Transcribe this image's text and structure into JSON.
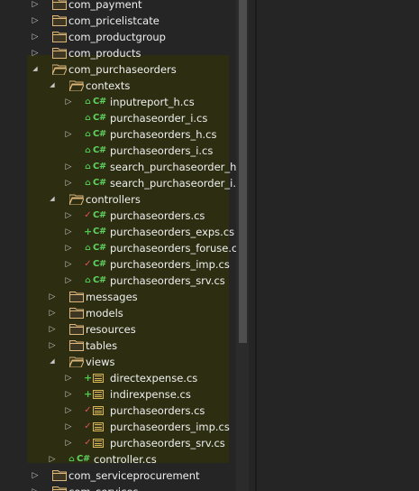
{
  "tree": {
    "rows": [
      {
        "label": "com_payment",
        "kind": "folder",
        "arrow": "collapsed",
        "badge": "",
        "icon": "folder-icon"
      },
      {
        "label": "com_pricelistcate",
        "kind": "folder",
        "arrow": "collapsed",
        "badge": "",
        "icon": "folder-icon"
      },
      {
        "label": "com_productgroup",
        "kind": "folder",
        "arrow": "collapsed",
        "badge": "",
        "icon": "folder-icon"
      },
      {
        "label": "com_products",
        "kind": "folder",
        "arrow": "collapsed",
        "badge": "",
        "icon": "folder-icon"
      },
      {
        "label": "com_purchaseorders",
        "kind": "folder",
        "arrow": "expanded",
        "badge": "",
        "icon": "folder-icon"
      },
      {
        "label": "contexts",
        "kind": "folder",
        "arrow": "expanded",
        "badge": "",
        "icon": "folder-icon"
      },
      {
        "label": "inputreport_h.cs",
        "kind": "cs",
        "arrow": "collapsed",
        "badge": "lock",
        "icon": "csharp-file-icon"
      },
      {
        "label": "purchaseorder_i.cs",
        "kind": "cs",
        "arrow": "none",
        "badge": "lock",
        "icon": "csharp-file-icon"
      },
      {
        "label": "purchaseorders_h.cs",
        "kind": "cs",
        "arrow": "collapsed",
        "badge": "lock",
        "icon": "csharp-file-icon"
      },
      {
        "label": "purchaseorders_i.cs",
        "kind": "cs",
        "arrow": "none",
        "badge": "lock",
        "icon": "csharp-file-icon"
      },
      {
        "label": "search_purchaseorder_h.cs",
        "kind": "cs",
        "arrow": "collapsed",
        "badge": "lock",
        "icon": "csharp-file-icon"
      },
      {
        "label": "search_purchaseorder_i.cs",
        "kind": "cs",
        "arrow": "collapsed",
        "badge": "lock",
        "icon": "csharp-file-icon"
      },
      {
        "label": "controllers",
        "kind": "folder",
        "arrow": "expanded",
        "badge": "",
        "icon": "folder-icon"
      },
      {
        "label": "purchaseorders.cs",
        "kind": "cs",
        "arrow": "collapsed",
        "badge": "check",
        "icon": "csharp-file-icon"
      },
      {
        "label": "purchaseorders_exps.cs",
        "kind": "cs",
        "arrow": "collapsed",
        "badge": "plus",
        "icon": "csharp-file-icon"
      },
      {
        "label": "purchaseorders_foruse.cs",
        "kind": "cs",
        "arrow": "collapsed",
        "badge": "lock",
        "icon": "csharp-file-icon"
      },
      {
        "label": "purchaseorders_imp.cs",
        "kind": "cs",
        "arrow": "collapsed",
        "badge": "check",
        "icon": "csharp-file-icon"
      },
      {
        "label": "purchaseorders_srv.cs",
        "kind": "cs",
        "arrow": "collapsed",
        "badge": "lock",
        "icon": "csharp-file-icon"
      },
      {
        "label": "messages",
        "kind": "folder",
        "arrow": "collapsed",
        "badge": "",
        "icon": "folder-icon"
      },
      {
        "label": "models",
        "kind": "folder",
        "arrow": "collapsed",
        "badge": "",
        "icon": "folder-icon"
      },
      {
        "label": "resources",
        "kind": "folder",
        "arrow": "collapsed",
        "badge": "",
        "icon": "folder-icon"
      },
      {
        "label": "tables",
        "kind": "folder",
        "arrow": "collapsed",
        "badge": "",
        "icon": "folder-icon"
      },
      {
        "label": "views",
        "kind": "folder",
        "arrow": "expanded",
        "badge": "",
        "icon": "folder-icon"
      },
      {
        "label": "directexpense.cs",
        "kind": "form",
        "arrow": "collapsed",
        "badge": "plus",
        "icon": "form-file-icon"
      },
      {
        "label": "indirexpense.cs",
        "kind": "form",
        "arrow": "collapsed",
        "badge": "plus",
        "icon": "form-file-icon"
      },
      {
        "label": "purchaseorders.cs",
        "kind": "form",
        "arrow": "collapsed",
        "badge": "check",
        "icon": "form-file-icon"
      },
      {
        "label": "purchaseorders_imp.cs",
        "kind": "form",
        "arrow": "collapsed",
        "badge": "check",
        "icon": "form-file-icon"
      },
      {
        "label": "purchaseorders_srv.cs",
        "kind": "form",
        "arrow": "collapsed",
        "badge": "check",
        "icon": "form-file-icon"
      },
      {
        "label": "controller.cs",
        "kind": "cs",
        "arrow": "collapsed",
        "badge": "lock",
        "icon": "csharp-file-icon"
      },
      {
        "label": "com_serviceprocurement",
        "kind": "folder",
        "arrow": "collapsed",
        "badge": "",
        "icon": "folder-icon"
      },
      {
        "label": "com_services",
        "kind": "folder",
        "arrow": "collapsed",
        "badge": "",
        "icon": "folder-icon"
      }
    ]
  },
  "icons": {
    "cs_text": "C#",
    "lock_glyph": "⌂",
    "check_glyph": "✓",
    "plus_glyph": "+"
  },
  "colors": {
    "selection": "#2d2d12",
    "folder": "#dcb67a",
    "csharp": "#5fd35f",
    "pending_check": "#e05252",
    "added": "#4ec94e"
  }
}
